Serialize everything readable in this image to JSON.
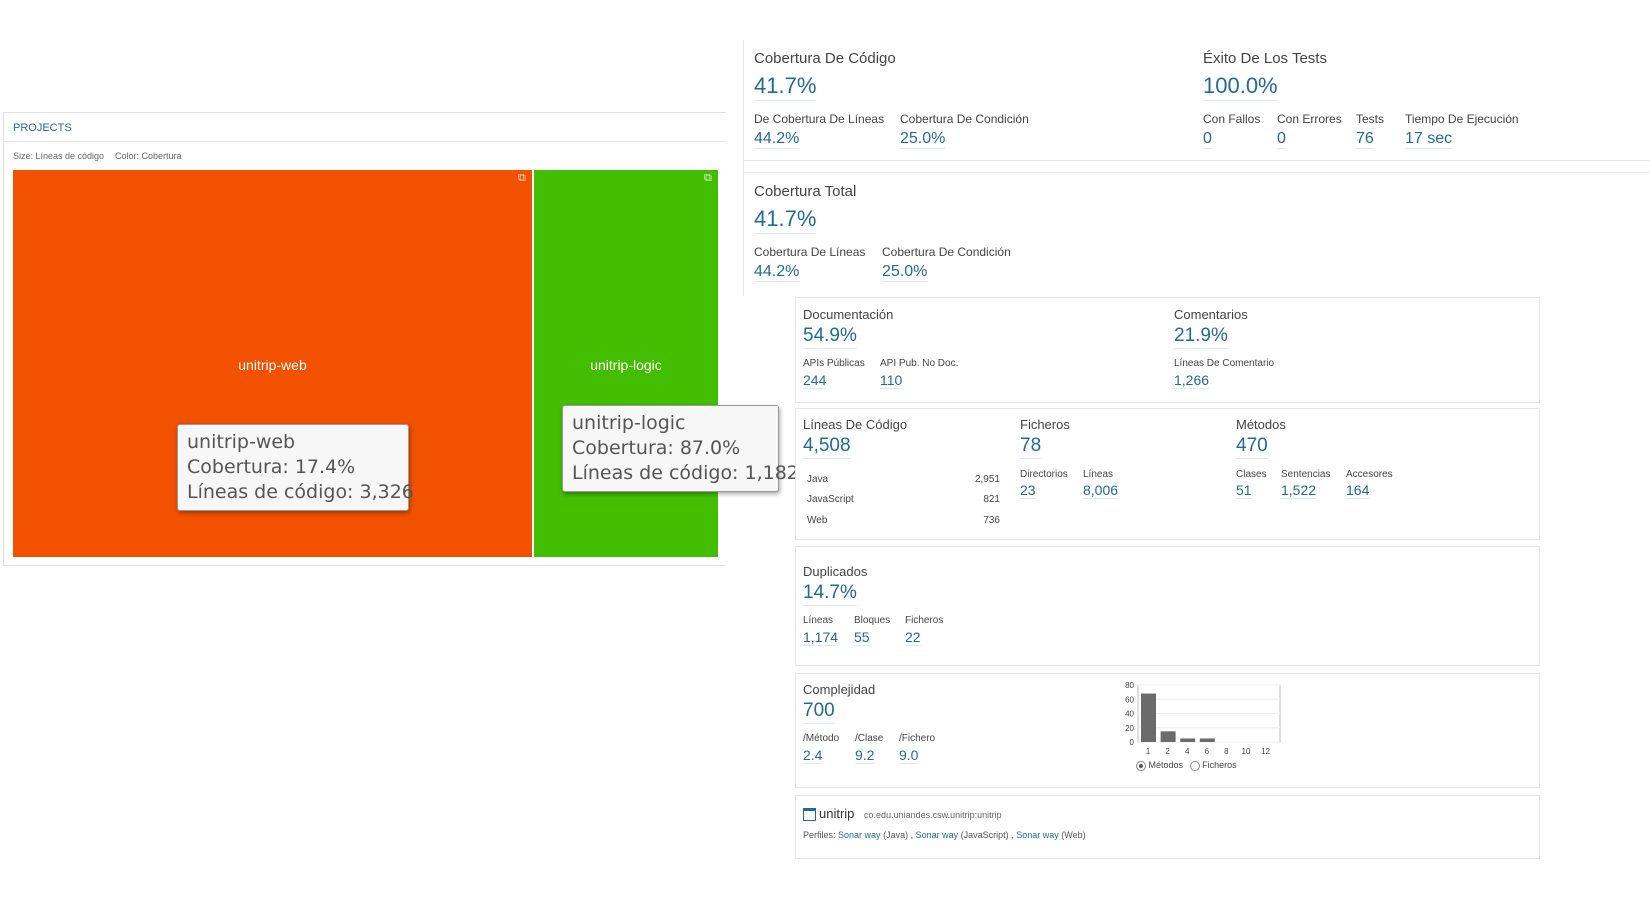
{
  "treemap": {
    "header": "PROJECTS",
    "size_label": "Size: Líneas de código",
    "color_label": "Color: Cobertura",
    "blocks": [
      {
        "name": "unitrip-web",
        "color": "#f25100"
      },
      {
        "name": "unitrip-logic",
        "color": "#43bd00"
      }
    ],
    "tooltips": [
      {
        "line1": "unitrip-web",
        "line2": "Cobertura: 17.4%",
        "line3": "Líneas de código: 3,326"
      },
      {
        "line1": "unitrip-logic",
        "line2": "Cobertura: 87.0%",
        "line3": "Líneas de código: 1,182"
      }
    ],
    "corner_icon": "expand-icon"
  },
  "coverage": {
    "title": "Cobertura De Código",
    "value": "41.7%",
    "lines_label": "De Cobertura De Líneas",
    "lines_value": "44.2%",
    "cond_label": "Cobertura De Condición",
    "cond_value": "25.0%"
  },
  "tests": {
    "title": "Éxito De Los Tests",
    "value": "100.0%",
    "failures_label": "Con Fallos",
    "failures_value": "0",
    "errors_label": "Con Errores",
    "errors_value": "0",
    "tests_label": "Tests",
    "tests_value": "76",
    "time_label": "Tiempo De Ejecución",
    "time_value": "17 sec"
  },
  "total_coverage": {
    "title": "Cobertura Total",
    "value": "41.7%",
    "lines_label": "Cobertura De Líneas",
    "lines_value": "44.2%",
    "cond_label": "Cobertura De Condición",
    "cond_value": "25.0%"
  },
  "documentation": {
    "title": "Documentación",
    "value": "54.9%",
    "public_api_label": "APIs Públicas",
    "public_api_value": "244",
    "undoc_label": "API Pub. No Doc.",
    "undoc_value": "110"
  },
  "comments": {
    "title": "Comentarios",
    "value": "21.9%",
    "lines_label": "Líneas De Comentario",
    "lines_value": "1,266"
  },
  "size": {
    "loc_title": "Líneas De Código",
    "loc_value": "4,508",
    "languages": [
      {
        "name": "Java",
        "value": "2,951"
      },
      {
        "name": "JavaScript",
        "value": "821"
      },
      {
        "name": "Web",
        "value": "736"
      }
    ],
    "files_title": "Ficheros",
    "files_value": "78",
    "dirs_label": "Directorios",
    "dirs_value": "23",
    "lines_label": "Líneas",
    "lines_value": "8,006",
    "methods_title": "Métodos",
    "methods_value": "470",
    "classes_label": "Clases",
    "classes_value": "51",
    "statements_label": "Sentencias",
    "statements_value": "1,522",
    "accessors_label": "Accesores",
    "accessors_value": "164"
  },
  "duplications": {
    "title": "Duplicados",
    "value": "14.7%",
    "lines_label": "Líneas",
    "lines_value": "1,174",
    "blocks_label": "Bloques",
    "blocks_value": "55",
    "files_label": "Ficheros",
    "files_value": "22"
  },
  "complexity": {
    "title": "Complejidad",
    "value": "700",
    "method_label": "/Método",
    "method_value": "2.4",
    "class_label": "/Clase",
    "class_value": "9.2",
    "file_label": "/Fichero",
    "file_value": "9.0",
    "radio_methods": "Métodos",
    "radio_files": "Ficheros"
  },
  "chart_data": {
    "type": "bar",
    "categories": [
      "1",
      "2",
      "4",
      "6",
      "8",
      "10",
      "12"
    ],
    "values": [
      68,
      15,
      5,
      5,
      0,
      0,
      0
    ],
    "y_ticks": [
      "80",
      "60",
      "40",
      "20",
      "0"
    ],
    "ylim": [
      0,
      80
    ],
    "grid": true,
    "title": "",
    "xlabel": "",
    "ylabel": ""
  },
  "project": {
    "name": "unitrip",
    "key": "co.edu.uniandes.csw.unitrip:unitrip",
    "profiles_label": "Perfiles:",
    "profile1": "Sonar way",
    "profile1_lang": "(Java) ,",
    "profile2": "Sonar way",
    "profile2_lang": "(JavaScript) ,",
    "profile3": "Sonar way",
    "profile3_lang": "(Web)",
    "icon": "project-icon"
  }
}
